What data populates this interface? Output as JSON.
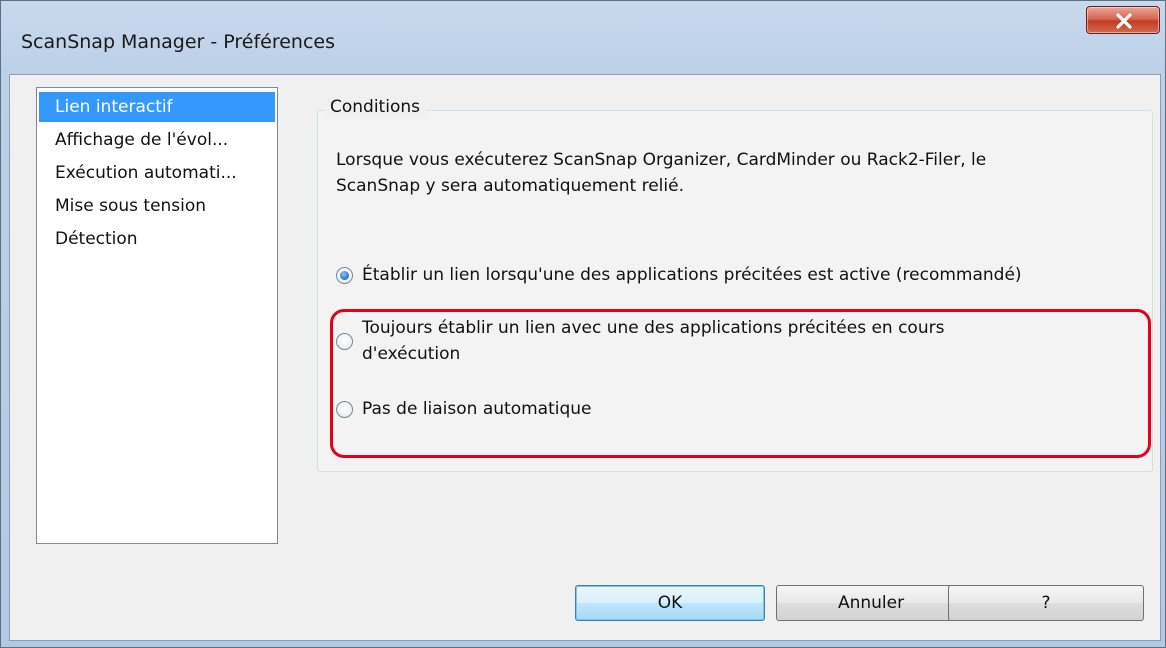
{
  "window": {
    "title": "ScanSnap Manager - Préférences",
    "close_icon": "close-icon"
  },
  "sidebar": {
    "items": [
      {
        "label": "Lien interactif",
        "selected": true
      },
      {
        "label": "Affichage de l'évol...",
        "selected": false
      },
      {
        "label": "Exécution automati...",
        "selected": false
      },
      {
        "label": "Mise sous tension",
        "selected": false
      },
      {
        "label": "Détection",
        "selected": false
      }
    ]
  },
  "conditions": {
    "group_label": "Conditions",
    "description_line1": "Lorsque vous exécuterez ScanSnap Organizer, CardMinder ou Rack2-Filer, le",
    "description_line2": "ScanSnap y sera automatiquement relié.",
    "options": [
      {
        "label": "Établir un lien lorsqu'une des applications précitées est active (recommandé)",
        "checked": true
      },
      {
        "label_line1": "Toujours établir un lien avec une des applications précitées en cours",
        "label_line2": "d'exécution",
        "checked": false
      },
      {
        "label": "Pas de liaison automatique",
        "checked": false
      }
    ],
    "highlight_color": "#e3001b"
  },
  "buttons": {
    "ok": "OK",
    "cancel": "Annuler",
    "help": "?"
  },
  "colors": {
    "selection": "#3399ff",
    "titlebar": "#bcd0e8",
    "close_button": "#c23d24"
  }
}
